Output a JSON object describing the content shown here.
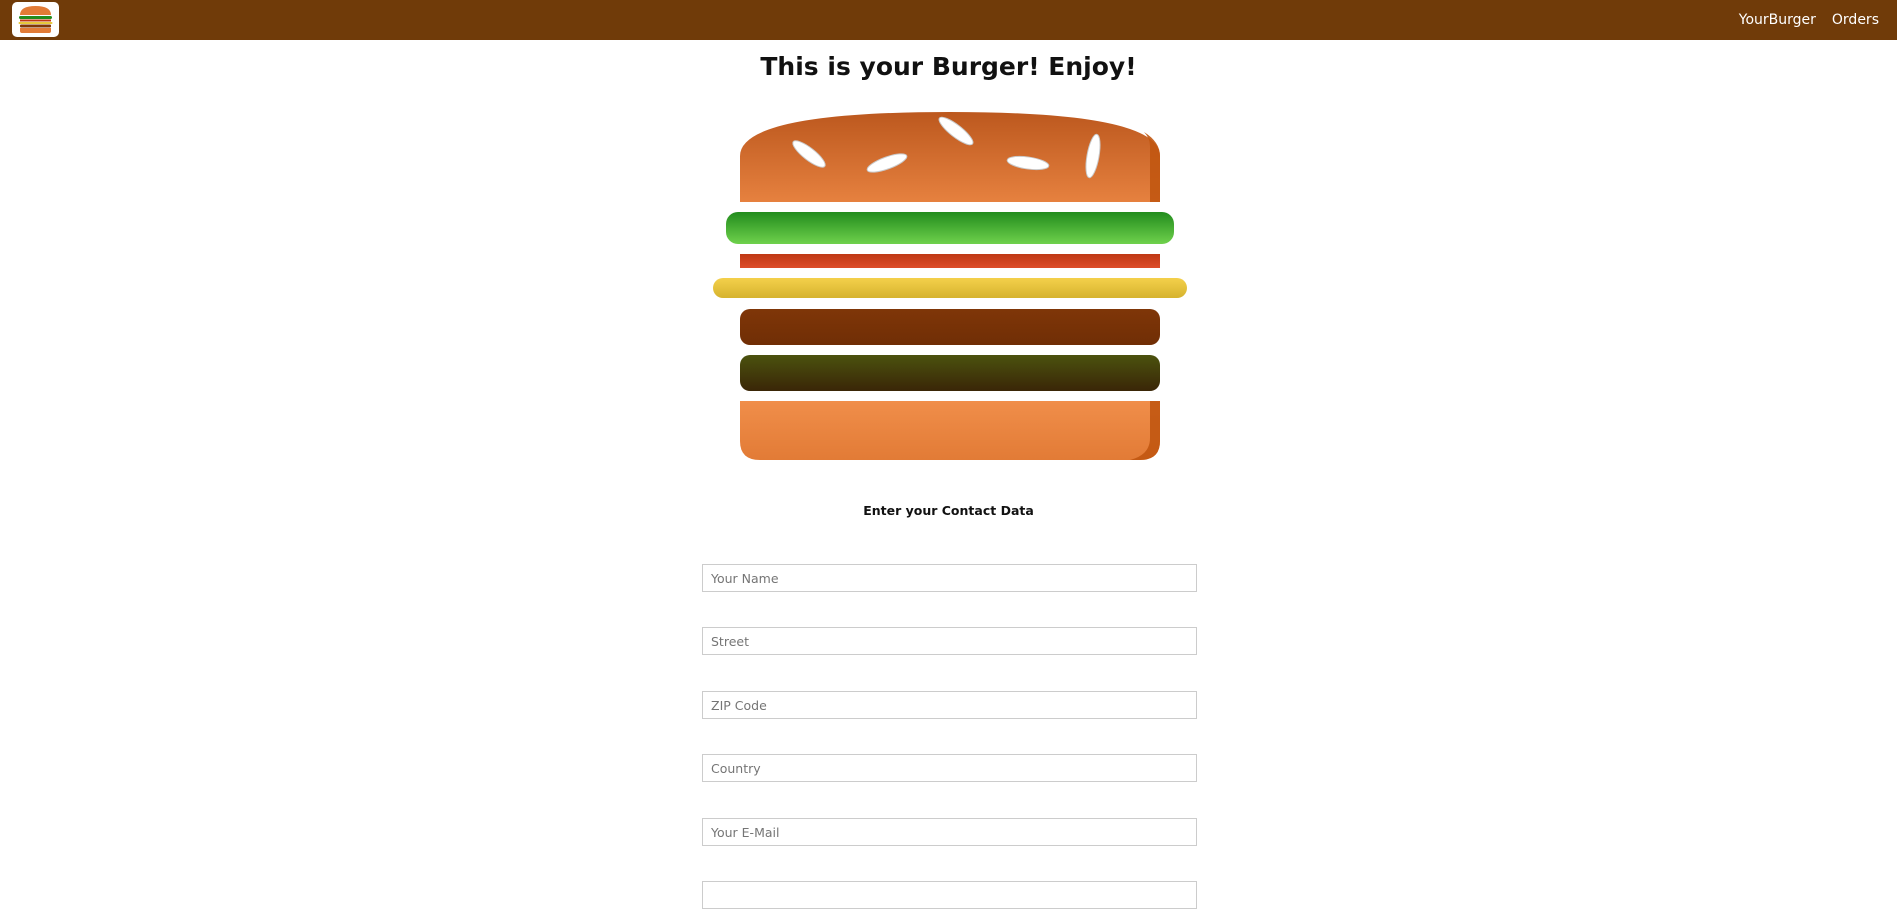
{
  "toolbar": {
    "logo_alt": "burger logo",
    "nav": [
      {
        "label": "YourBurger"
      },
      {
        "label": "Orders"
      }
    ]
  },
  "main": {
    "title": "This is your Burger! Enjoy!",
    "burger_layers": [
      "bread-top",
      "salad",
      "bacon",
      "cheese",
      "meat",
      "meat-dark",
      "bread-bottom"
    ],
    "contact_heading": "Enter your Contact Data"
  },
  "form": {
    "fields": [
      {
        "placeholder": "Your Name",
        "value": ""
      },
      {
        "placeholder": "Street",
        "value": ""
      },
      {
        "placeholder": "ZIP Code",
        "value": ""
      },
      {
        "placeholder": "Country",
        "value": ""
      },
      {
        "placeholder": "Your E-Mail",
        "value": ""
      }
    ]
  },
  "colors": {
    "toolbar": "#703B09",
    "bread": "#E27B36",
    "salad": "#228C1D",
    "bacon": "#BF3813",
    "cheese": "#E6C83B",
    "meat": "#7F3608",
    "meat_dark": "#3F4A0A"
  }
}
